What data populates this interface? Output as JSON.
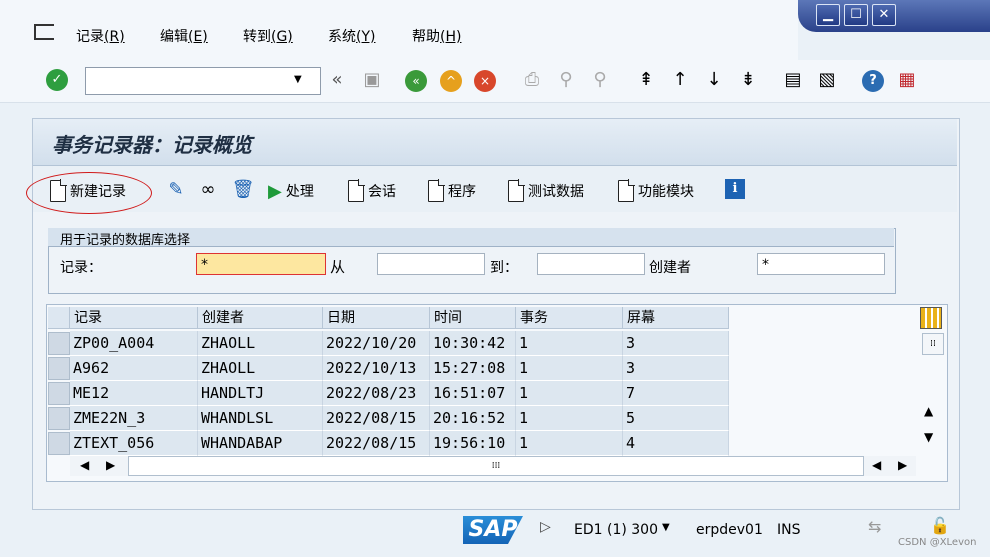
{
  "menu": {
    "items": [
      "记录(R)",
      "编辑(E)",
      "转到(G)",
      "系统(Y)",
      "帮助(H)"
    ],
    "labels": [
      "记录",
      "编辑",
      "转到",
      "系统",
      "帮助"
    ],
    "keys": [
      "(R)",
      "(E)",
      "(G)",
      "(Y)",
      "(H)"
    ]
  },
  "toolbar": {
    "command_value": ""
  },
  "screen": {
    "title": "事务记录器：记录概览"
  },
  "actions": {
    "new_record": "新建记录",
    "process": "处理",
    "session": "会话",
    "program": "程序",
    "test_data": "测试数据",
    "function_module": "功能模块"
  },
  "selection": {
    "group_title": "用于记录的数据库选择",
    "record_label": "记录：",
    "record_value": "*",
    "from_label": "从",
    "from_value": "",
    "to_label": "到：",
    "to_value": "",
    "creator_label": "创建者",
    "creator_value": "*"
  },
  "table": {
    "columns": [
      "记录",
      "创建者",
      "日期",
      "时间",
      "事务",
      "屏幕"
    ],
    "rows": [
      [
        "ZP00_A004",
        "ZHAOLL",
        "2022/10/20",
        "10:30:42",
        "1",
        "3"
      ],
      [
        "A962",
        "ZHAOLL",
        "2022/10/13",
        "15:27:08",
        "1",
        "3"
      ],
      [
        "ME12",
        "HANDLTJ",
        "2022/08/23",
        "16:51:07",
        "1",
        "7"
      ],
      [
        "ZME22N_3",
        "WHANDLSL",
        "2022/08/15",
        "20:16:52",
        "1",
        "5"
      ],
      [
        "ZTEXT_056",
        "WHANDABAP",
        "2022/08/15",
        "19:56:10",
        "1",
        "4"
      ]
    ]
  },
  "status": {
    "sap_logo": "SAP",
    "system": "ED1 (1) 300",
    "server": "erpdev01",
    "mode": "INS",
    "watermark": "CSDN @XLevon"
  }
}
